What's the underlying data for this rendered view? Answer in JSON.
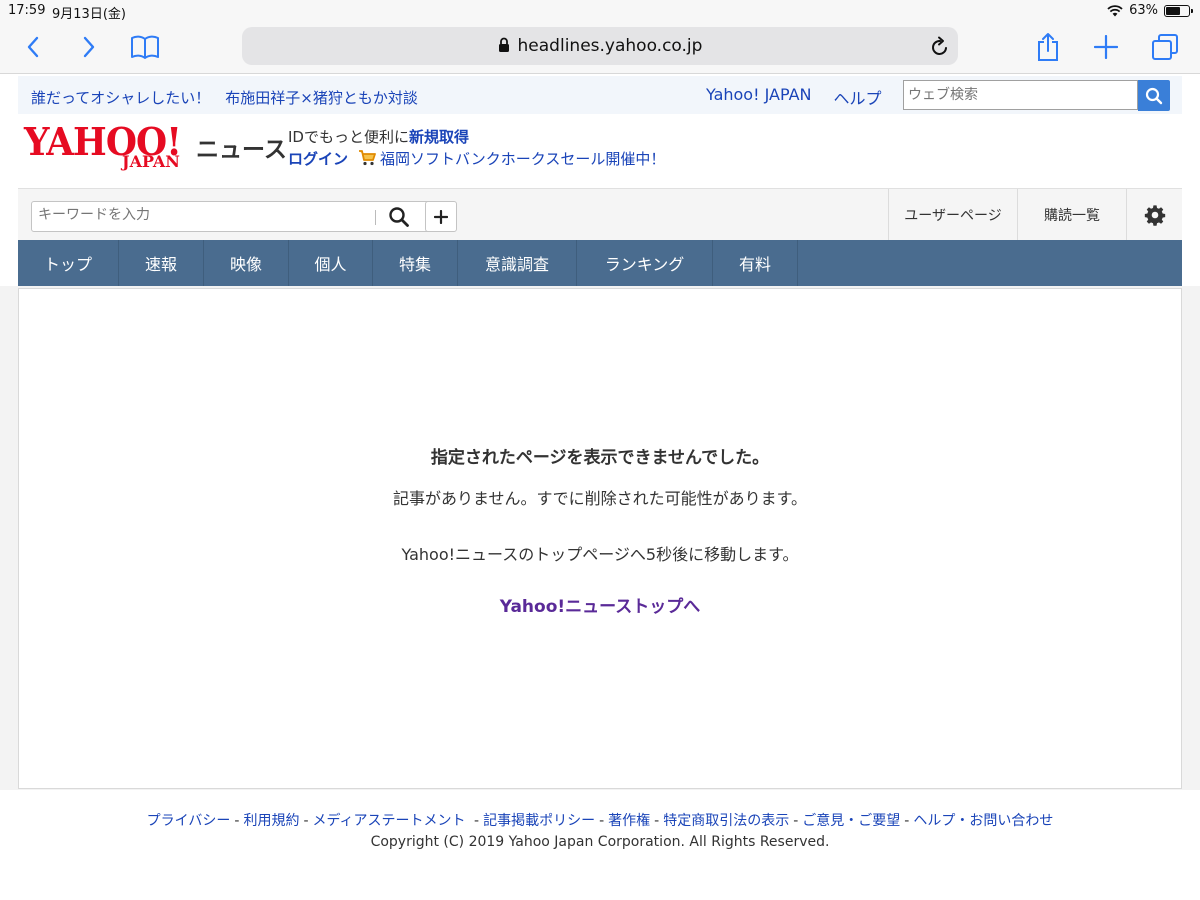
{
  "status_bar": {
    "time": "17:59",
    "date": "9月13日(金)",
    "battery": "63%",
    "battery_level": 0.63
  },
  "browser": {
    "url": "headlines.yahoo.co.jp"
  },
  "promo_bar": {
    "ad_text": "誰だってオシャレしたい！　布施田祥子×猪狩ともか対談",
    "yahoo_japan": "Yahoo! JAPAN",
    "help": "ヘルプ",
    "web_search_placeholder": "ウェブ検索"
  },
  "header": {
    "logo_main": "YAHOO!",
    "logo_sub": "JAPAN",
    "logo_service": "ニュース",
    "id_text": "IDでもっと便利に",
    "signup": "新規取得",
    "login": "ログイン",
    "promo": "福岡ソフトバンクホークスセール開催中！"
  },
  "search": {
    "keyword_placeholder": "キーワードを入力",
    "user_page": "ユーザーページ",
    "subscriptions": "購読一覧"
  },
  "nav": [
    "トップ",
    "速報",
    "映像",
    "個人",
    "特集",
    "意識調査",
    "ランキング",
    "有料"
  ],
  "error": {
    "title": "指定されたページを表示できませんでした。",
    "message": "記事がありません。すでに削除された可能性があります。",
    "redirect": "Yahoo!ニュースのトップページへ5秒後に移動します。",
    "link": "Yahoo!ニューストップへ"
  },
  "footer": {
    "links": [
      "プライバシー",
      "利用規約",
      "メディアステートメント",
      "記事掲載ポリシー",
      "著作権",
      "特定商取引法の表示",
      "ご意見・ご要望",
      "ヘルプ・お問い合わせ"
    ],
    "copyright": "Copyright (C) 2019 Yahoo Japan Corporation. All Rights Reserved."
  },
  "colors": {
    "nav_bg": "#4a6c8f",
    "link_blue": "#1a44b8",
    "yahoo_red": "#e60b22",
    "visited_purple": "#5a2a98",
    "search_btn": "#3a7fd8"
  }
}
